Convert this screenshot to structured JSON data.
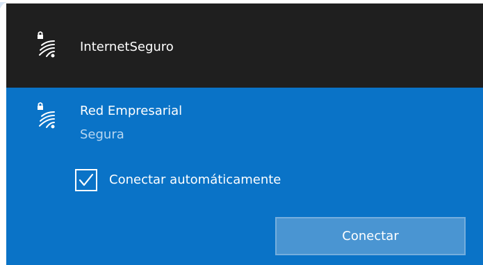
{
  "networks": [
    {
      "name": "InternetSeguro",
      "icon": "secured-wifi-icon"
    },
    {
      "name": "Red Empresarial",
      "status": "Segura",
      "icon": "secured-wifi-icon",
      "auto_connect_label": "Conectar automáticamente",
      "auto_connect_checked": true,
      "connect_button_label": "Conectar"
    }
  ],
  "colors": {
    "flyout_background": "#1f1f1f",
    "selected_background": "#0a73c7",
    "status_text": "#b8d7f1",
    "button_background": "#4a95d2",
    "button_border": "#75aedd",
    "text": "#ffffff"
  }
}
